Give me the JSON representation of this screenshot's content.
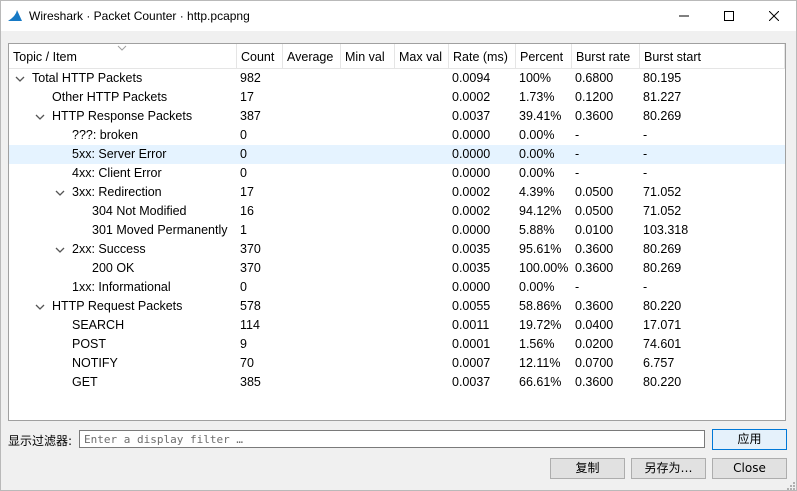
{
  "window": {
    "title": "Wireshark · Packet Counter · http.pcapng",
    "icon": "wireshark-fin-icon",
    "minimize_icon": "minimize-icon",
    "maximize_icon": "maximize-icon",
    "close_icon": "close-icon"
  },
  "columns": [
    "Topic / Item",
    "Count",
    "Average",
    "Min val",
    "Max val",
    "Rate (ms)",
    "Percent",
    "Burst rate",
    "Burst start"
  ],
  "rows": [
    {
      "topic": "Total HTTP Packets",
      "count": "982",
      "average": "",
      "min": "",
      "max": "",
      "rate": "0.0094",
      "percent": "100%",
      "burst_rate": "0.6800",
      "burst_start": "80.195",
      "expanded": true
    },
    {
      "topic": "Other HTTP Packets",
      "count": "17",
      "average": "",
      "min": "",
      "max": "",
      "rate": "0.0002",
      "percent": "1.73%",
      "burst_rate": "0.1200",
      "burst_start": "81.227"
    },
    {
      "topic": "HTTP Response Packets",
      "count": "387",
      "average": "",
      "min": "",
      "max": "",
      "rate": "0.0037",
      "percent": "39.41%",
      "burst_rate": "0.3600",
      "burst_start": "80.269",
      "expanded": true
    },
    {
      "topic": "???: broken",
      "count": "0",
      "average": "",
      "min": "",
      "max": "",
      "rate": "0.0000",
      "percent": "0.00%",
      "burst_rate": "-",
      "burst_start": "-"
    },
    {
      "topic": "5xx: Server Error",
      "count": "0",
      "average": "",
      "min": "",
      "max": "",
      "rate": "0.0000",
      "percent": "0.00%",
      "burst_rate": "-",
      "burst_start": "-",
      "selected": true
    },
    {
      "topic": "4xx: Client Error",
      "count": "0",
      "average": "",
      "min": "",
      "max": "",
      "rate": "0.0000",
      "percent": "0.00%",
      "burst_rate": "-",
      "burst_start": "-"
    },
    {
      "topic": "3xx: Redirection",
      "count": "17",
      "average": "",
      "min": "",
      "max": "",
      "rate": "0.0002",
      "percent": "4.39%",
      "burst_rate": "0.0500",
      "burst_start": "71.052",
      "expanded": true
    },
    {
      "topic": "304 Not Modified",
      "count": "16",
      "average": "",
      "min": "",
      "max": "",
      "rate": "0.0002",
      "percent": "94.12%",
      "burst_rate": "0.0500",
      "burst_start": "71.052"
    },
    {
      "topic": "301 Moved Permanently",
      "count": "1",
      "average": "",
      "min": "",
      "max": "",
      "rate": "0.0000",
      "percent": "5.88%",
      "burst_rate": "0.0100",
      "burst_start": "103.318"
    },
    {
      "topic": "2xx: Success",
      "count": "370",
      "average": "",
      "min": "",
      "max": "",
      "rate": "0.0035",
      "percent": "95.61%",
      "burst_rate": "0.3600",
      "burst_start": "80.269",
      "expanded": true
    },
    {
      "topic": "200 OK",
      "count": "370",
      "average": "",
      "min": "",
      "max": "",
      "rate": "0.0035",
      "percent": "100.00%",
      "burst_rate": "0.3600",
      "burst_start": "80.269"
    },
    {
      "topic": "1xx: Informational",
      "count": "0",
      "average": "",
      "min": "",
      "max": "",
      "rate": "0.0000",
      "percent": "0.00%",
      "burst_rate": "-",
      "burst_start": "-"
    },
    {
      "topic": "HTTP Request Packets",
      "count": "578",
      "average": "",
      "min": "",
      "max": "",
      "rate": "0.0055",
      "percent": "58.86%",
      "burst_rate": "0.3600",
      "burst_start": "80.220",
      "expanded": true
    },
    {
      "topic": "SEARCH",
      "count": "114",
      "average": "",
      "min": "",
      "max": "",
      "rate": "0.0011",
      "percent": "19.72%",
      "burst_rate": "0.0400",
      "burst_start": "17.071"
    },
    {
      "topic": "POST",
      "count": "9",
      "average": "",
      "min": "",
      "max": "",
      "rate": "0.0001",
      "percent": "1.56%",
      "burst_rate": "0.0200",
      "burst_start": "74.601"
    },
    {
      "topic": "NOTIFY",
      "count": "70",
      "average": "",
      "min": "",
      "max": "",
      "rate": "0.0007",
      "percent": "12.11%",
      "burst_rate": "0.0700",
      "burst_start": "6.757"
    },
    {
      "topic": "GET",
      "count": "385",
      "average": "",
      "min": "",
      "max": "",
      "rate": "0.0037",
      "percent": "66.61%",
      "burst_rate": "0.3600",
      "burst_start": "80.220"
    }
  ],
  "filter": {
    "label": "显示过滤器:",
    "placeholder": "Enter a display filter …",
    "apply_label": "应用"
  },
  "buttons": {
    "copy": "复制",
    "save_as": "另存为…",
    "close": "Close"
  },
  "colors": {
    "selected_row": "#e5f3ff",
    "accent": "#0078d7"
  }
}
